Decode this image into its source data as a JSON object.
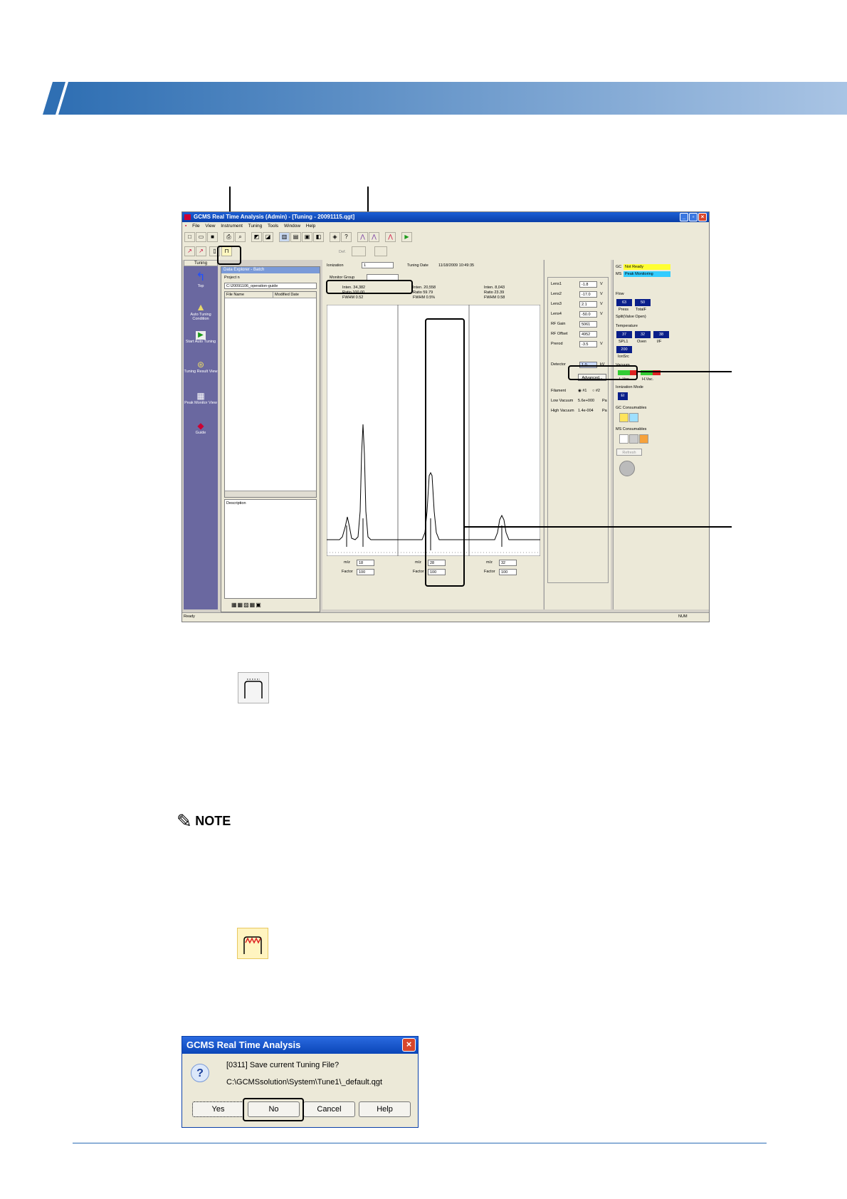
{
  "window": {
    "title": "GCMS Real Time Analysis (Admin) - [Tuning - 20091115.qgt]",
    "menu": [
      "File",
      "View",
      "Instrument",
      "Tuning",
      "Tools",
      "Window",
      "Help"
    ],
    "status_left": "Ready",
    "status_right": "NUM"
  },
  "assistant_bar": {
    "title": "Tuning",
    "items": [
      "Top",
      "Auto Tuning Condition",
      "Start Auto Tuning",
      "Tuning Result View",
      "Peak Monitor View",
      "Guide"
    ]
  },
  "explorer": {
    "title": "Data Explorer - Batch",
    "tab": "Project n",
    "path": "C:\\20091106_operation-guide",
    "col_file": "File Name",
    "col_date": "Modified Date",
    "description_label": "Description"
  },
  "tuning": {
    "ionization_label": "Ionization",
    "ionization_value": "1",
    "tuning_date_label": "Tuning Date",
    "tuning_date_value": "11/18/2009 10:49:35",
    "monitor_group_label": "Monitor Group",
    "def_label": "Def.",
    "peaks": [
      {
        "inten": "34,382",
        "ratio": "100.00",
        "fwhm": "0.52",
        "mz": "18",
        "factor": "100"
      },
      {
        "inten": "20,558",
        "ratio": "59.79",
        "fwhm": "0.5%",
        "mz": "28",
        "factor": "100"
      },
      {
        "inten": "8,043",
        "ratio": "23.39",
        "fwhm": "0.58",
        "mz": "32",
        "factor": "100"
      }
    ],
    "inten_label": "Inten.",
    "ratio_label": "Ratio",
    "fwhm_label": "FWHM",
    "mz_label": "m/z",
    "factor_label": "Factor"
  },
  "lens": {
    "rows": [
      {
        "label": "Lens1",
        "value": "-1.8",
        "unit": "V"
      },
      {
        "label": "Lens2",
        "value": "-17.0",
        "unit": "V"
      },
      {
        "label": "Lens3",
        "value": "2.1",
        "unit": "V"
      },
      {
        "label": "Lens4",
        "value": "-50.0",
        "unit": "V"
      },
      {
        "label": "RF Gain",
        "value": "5061",
        "unit": ""
      },
      {
        "label": "RF Offset",
        "value": "4952",
        "unit": ""
      },
      {
        "label": "Prerod",
        "value": "-3.5",
        "unit": "V"
      }
    ],
    "detector_label": "Detector",
    "detector_value": "1.0",
    "detector_unit": "kV",
    "advanced_btn": "Advanced...",
    "filament_label": "Filament",
    "filament_opt1": "#1",
    "filament_opt2": "#2",
    "low_vac_label": "Low Vacuum",
    "low_vac_value": "5.6e+000",
    "high_vac_label": "High Vacuum",
    "high_vac_value": "1.4e-004",
    "pa": "Pa"
  },
  "monitor": {
    "gc_label": "GC",
    "gc_status": "Not Ready",
    "ms_label": "MS",
    "ms_status": "Peak Monitoring",
    "flow_label": "Flow",
    "flow_values": [
      "63",
      "50"
    ],
    "flow_captions": [
      "Press",
      "TotalF"
    ],
    "split_label": "Split(Valve Open)",
    "temp_label": "Temperature",
    "temp_values": [
      "37",
      "32",
      "38"
    ],
    "temp_captions": [
      "SPL1",
      "Oven",
      "I/F"
    ],
    "ion_src_value": "200",
    "ion_src_label": "IonSrc",
    "vacuum_label": "Vacuum",
    "vacuum_captions": [
      "L.Vac.",
      "H.Vac."
    ],
    "ion_mode_label": "Ionization Mode",
    "ion_mode_value": "EI",
    "gc_consumables": "GC Consumables",
    "ms_consumables": "MS Consumables",
    "refresh_btn": "Refresh"
  },
  "note_label": "NOTE",
  "dialog": {
    "title": "GCMS Real Time Analysis",
    "message": "[0311] Save current Tuning File?",
    "path": "C:\\GCMSsolution\\System\\Tune1\\_default.qgt",
    "buttons": [
      "Yes",
      "No",
      "Cancel",
      "Help"
    ]
  },
  "colors": {
    "header_left": "#2f6fb3",
    "header_right": "#a9c4e4",
    "title_blue": "#0a3fa8",
    "gc_status_bg": "#ffff33",
    "ms_status_bg": "#33ccff",
    "value_box": "#0a1f8a"
  }
}
